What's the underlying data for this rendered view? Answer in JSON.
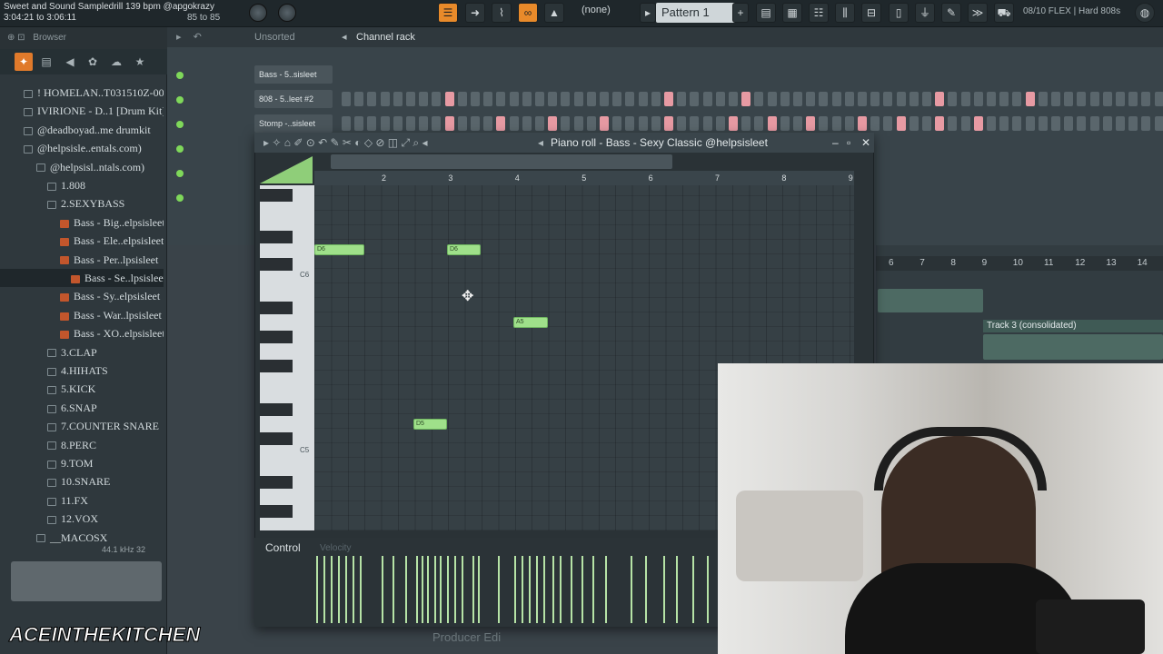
{
  "topbar": {
    "song_title": "Sweet and Sound Sampledrill 139 bpm @apgokrazy",
    "time_range": "3:04:21 to 3:06:11",
    "tempo_range": "85 to 85",
    "snap_value": "(none)",
    "pattern": "Pattern 1",
    "cpu_info": "08/10  FLEX | Hard 808s"
  },
  "browser": {
    "title": "Browser",
    "tree": [
      {
        "label": "! HOMELAN..T031510Z-001",
        "type": "folder"
      },
      {
        "label": "IVIRIONE - D..1 [Drum Kit]",
        "type": "folder"
      },
      {
        "label": "@deadboyad..me drumkit",
        "type": "folder"
      },
      {
        "label": "@helpsisle..entals.com)",
        "type": "folder"
      },
      {
        "label": "@helpsisl..ntals.com)",
        "type": "folder"
      },
      {
        "label": "1.808",
        "type": "folder"
      },
      {
        "label": "2.SEXYBASS",
        "type": "folder"
      },
      {
        "label": "Bass - Big..elpsisleet",
        "type": "file"
      },
      {
        "label": "Bass - Ele..elpsisleet",
        "type": "file"
      },
      {
        "label": "Bass - Per..lpsisleet",
        "type": "file"
      },
      {
        "label": "Bass - Se..lpsisleet",
        "type": "file",
        "selected": true
      },
      {
        "label": "Bass - Sy..elpsisleet",
        "type": "file"
      },
      {
        "label": "Bass - War..lpsisleet",
        "type": "file"
      },
      {
        "label": "Bass - XO..elpsisleet",
        "type": "file"
      },
      {
        "label": "3.CLAP",
        "type": "folder"
      },
      {
        "label": "4.HIHATS",
        "type": "folder"
      },
      {
        "label": "5.KICK",
        "type": "folder"
      },
      {
        "label": "6.SNAP",
        "type": "folder"
      },
      {
        "label": "7.COUNTER SNARE",
        "type": "folder"
      },
      {
        "label": "8.PERC",
        "type": "folder"
      },
      {
        "label": "9.TOM",
        "type": "folder"
      },
      {
        "label": "10.SNARE",
        "type": "folder"
      },
      {
        "label": "11.FX",
        "type": "folder"
      },
      {
        "label": "12.VOX",
        "type": "folder"
      },
      {
        "label": "__MACOSX",
        "type": "folder"
      }
    ],
    "sample_info": "44.1 kHz 32"
  },
  "channel_rack": {
    "sort": "Unsorted",
    "title": "Channel rack",
    "channels": [
      "Bass - 5..sisleet",
      "808 - 5..leet #2",
      "Stomp -..sisleet"
    ]
  },
  "playlist": {
    "bars": [
      "6",
      "7",
      "8",
      "9",
      "10",
      "11",
      "12",
      "13",
      "14"
    ],
    "track_clip": "Track 3 (consolidated)"
  },
  "pianoroll": {
    "title": "Piano roll - Bass - Sexy Classic @helpsisleet",
    "ruler": [
      "2",
      "3",
      "4",
      "5",
      "6",
      "7",
      "8",
      "9"
    ],
    "key_labels": {
      "c6": "C6",
      "c5": "C5"
    },
    "notes": [
      {
        "label": "D6",
        "row": "d6a"
      },
      {
        "label": "D6",
        "row": "d6b"
      },
      {
        "label": "A5",
        "row": "a5"
      },
      {
        "label": "D5",
        "row": "d5"
      }
    ],
    "control_label": "Control",
    "control_target": "Velocity"
  },
  "overlay": {
    "brand": "ACEINTHEKITCHEN",
    "producer_edition": "Producer Edi"
  }
}
